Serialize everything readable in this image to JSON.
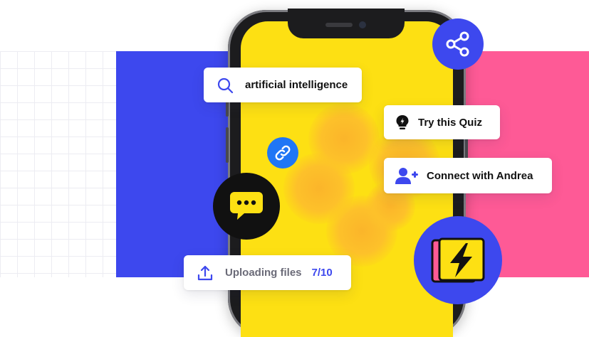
{
  "search": {
    "query": "artificial intelligence",
    "icon": "search-icon"
  },
  "quiz": {
    "label": "Try this Quiz",
    "icon": "lightbulb-icon"
  },
  "connect": {
    "label": "Connect with Andrea",
    "icon": "add-user-icon"
  },
  "upload": {
    "label": "Uploading files",
    "count": "7/10",
    "icon": "upload-icon"
  },
  "icons": {
    "share": "share-icon",
    "link": "link-icon",
    "chat": "chat-bubble-icon",
    "app": "lightning-bolt-icon"
  },
  "colors": {
    "brand_blue": "#3d48ee",
    "accent_pink": "#fe5a96",
    "screen_yellow": "#fde013",
    "link_blue": "#1f76f5",
    "dark": "#111111"
  }
}
